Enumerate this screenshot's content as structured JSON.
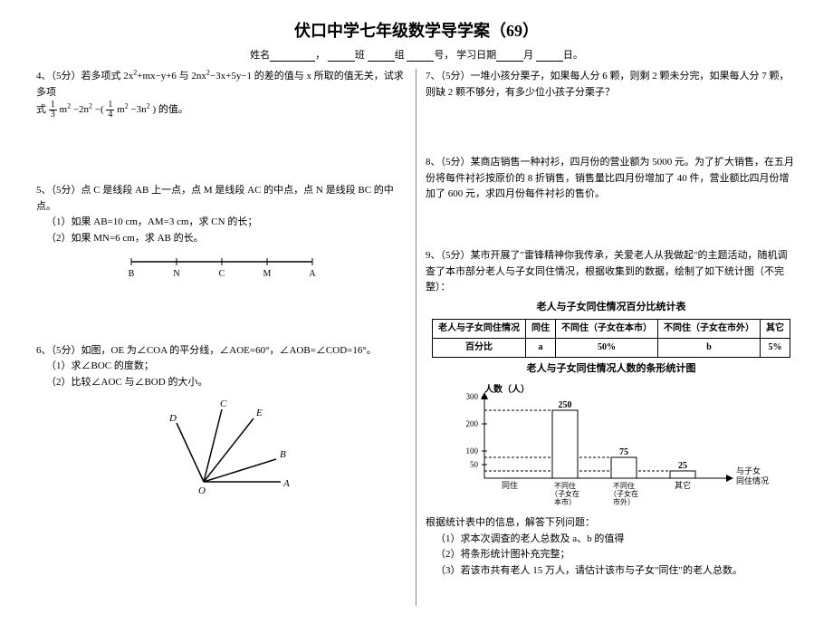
{
  "title": "伏口中学七年级数学导学案（69）",
  "header": {
    "name_label": "姓名",
    "class_label": "班",
    "group_label": "组",
    "num_label": "号，",
    "date_label": "学习日期",
    "month_label": "月",
    "day_label": "日。"
  },
  "q4": {
    "prefix": "4、（5分）若多项式 2x",
    "mid1": "+mx−y+6 与 2nx",
    "mid2": "−3x+5y−1 的差的值与 x 所取的值无关，试求多项",
    "line2a": "式",
    "line2b": "m",
    "line2c": "−2n",
    "line2d": "−(",
    "line2e": "m",
    "line2f": "−3n",
    "line2g": ") 的值。",
    "frac1n": "1",
    "frac1d": "3",
    "frac2n": "1",
    "frac2d": "4"
  },
  "q5": {
    "text": "5、（5分）点 C 是线段 AB 上一点，点 M 是线段 AC 的中点，点 N 是线段 BC 的中点。",
    "s1": "（1）如果 AB=10 cm，AM=3 cm，求 CN 的长；",
    "s2": "（2）如果 MN=6 cm，求 AB 的长。",
    "labels": {
      "B": "B",
      "N": "N",
      "C": "C",
      "M": "M",
      "A": "A"
    }
  },
  "q6": {
    "text": "6、（5分）如图，OE 为∠COA 的平分线，∠AOE=60°，∠AOB=∠COD=16°。",
    "s1": "（1）求∠BOC 的度数；",
    "s2": "（2）比较∠AOC 与∠BOD 的大小。",
    "labels": {
      "D": "D",
      "C": "C",
      "E": "E",
      "B": "B",
      "O": "O",
      "A": "A"
    }
  },
  "q7": {
    "text": "7、（5分）一堆小孩分栗子，如果每人分 6 颗，则剩 2 颗未分完，如果每人分 7 颗，则缺 2 颗不够分，有多少位小孩子分栗子？"
  },
  "q8": {
    "text": "8、（5分）某商店销售一种衬衫，四月份的营业额为 5000 元。为了扩大销售，在五月份将每件衬衫按原价的 8 折销售，销售量比四月份增加了 40 件，营业额比四月份增加了 600 元，求四月份每件衬衫的售价。"
  },
  "q9": {
    "text": "9、（5分）某市开展了\"雷锋精神你我传承，关爱老人从我做起\"的主题活动，随机调查了本市部分老人与子女同住情况，根据收集到的数据，绘制了如下统计图（不完整）：",
    "table_title": "老人与子女同住情况百分比统计表",
    "row1c1": "老人与子女同住情况",
    "row1c2": "同住",
    "row1c3": "不同住（子女在本市）",
    "row1c4": "不同住（子女在市外）",
    "row1c5": "其它",
    "row2c1": "百分比",
    "row2c2": "a",
    "row2c3": "50%",
    "row2c4": "b",
    "row2c5": "5%",
    "chart_title": "老人与子女同住情况人数的条形统计图",
    "ylabel": "人数（人）",
    "xlabel_note": "与子女同住情况",
    "ticks": {
      "t50": "50",
      "t100": "100",
      "t200": "200",
      "t300": "300"
    },
    "bars": {
      "b1": "",
      "b2": "250",
      "b3": "75",
      "b4": "25"
    },
    "cats": {
      "c1": "同住",
      "c2": "不同住（子女在本市）",
      "c3": "不同住（子女在市外）",
      "c4": "其它"
    },
    "after": "根据统计表中的信息，解答下列问题：",
    "p1": "（1）求本次调查的老人总数及 a、b 的值得",
    "p2": "（2）将条形统计图补充完整；",
    "p3": "（3）若该市共有老人 15 万人，请估计该市与子女\"同住\"的老人总数。"
  },
  "chart_data": {
    "type": "bar",
    "title": "老人与子女同住情况人数的条形统计图",
    "ylabel": "人数（人）",
    "categories": [
      "同住",
      "不同住（子女在本市）",
      "不同住（子女在市外）",
      "其它"
    ],
    "values": [
      null,
      250,
      75,
      25
    ],
    "ylim": [
      0,
      300
    ],
    "yticks": [
      50,
      100,
      200,
      300
    ]
  }
}
